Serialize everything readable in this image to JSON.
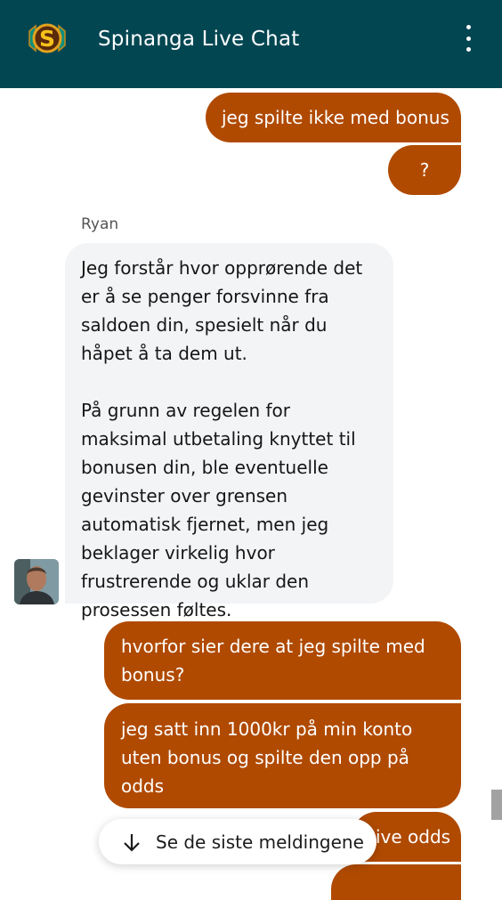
{
  "header": {
    "title": "Spinanga Live Chat",
    "logo_letter": "S",
    "menu_icon": "kebab-menu-icon",
    "background": "#024652"
  },
  "messages": {
    "out_1": "jeg spilte ikke med bonus",
    "out_2": "?",
    "agent_name": "Ryan",
    "agent_p1": "Jeg forstår hvor opprørende det er å se penger forsvinne fra saldoen din, spesielt når du håpet å ta dem ut.",
    "agent_p2": "På grunn av regelen for maksimal utbetaling knyttet til bonusen din, ble eventuelle gevinster over grensen automatisk fjernet, men jeg beklager virkelig hvor frustrerende og uklar den prosessen føltes.",
    "out_3": "hvorfor sier dere at jeg spilte med bonus?",
    "out_4": "jeg satt inn 1000kr på min konto uten bonus og spilte den opp på odds",
    "out_5_partial": "ive odds"
  },
  "jump_button": {
    "label": "Se de siste meldingene",
    "icon": "arrow-down-icon"
  },
  "colors": {
    "outgoing": "#b04a00",
    "incoming": "#f3f4f6",
    "header": "#024652"
  }
}
